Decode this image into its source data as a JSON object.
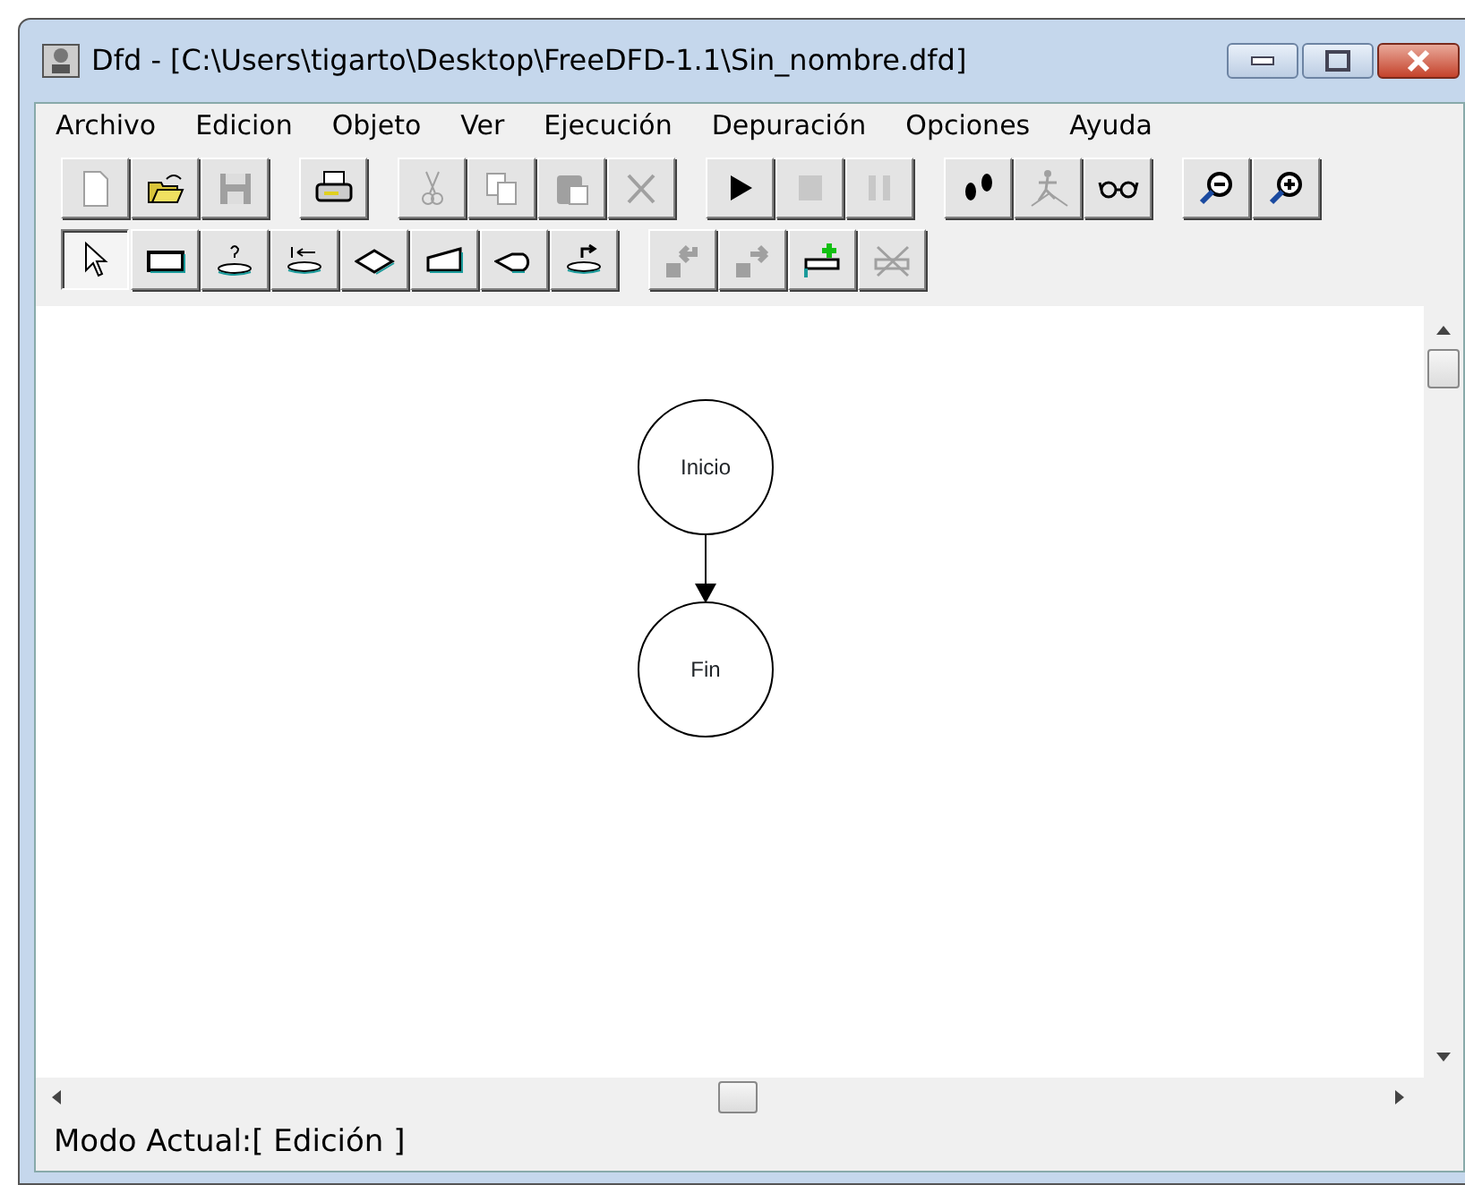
{
  "window": {
    "title": "Dfd - [C:\\Users\\tigarto\\Desktop\\FreeDFD-1.1\\Sin_nombre.dfd]"
  },
  "menu": [
    "Archivo",
    "Edicion",
    "Objeto",
    "Ver",
    "Ejecución",
    "Depuración",
    "Opciones",
    "Ayuda"
  ],
  "toolbars": [
    [
      [
        {
          "kind": "new",
          "disabled": true
        },
        {
          "kind": "open",
          "disabled": false
        },
        {
          "kind": "save",
          "disabled": true
        }
      ],
      [
        {
          "kind": "print",
          "disabled": false
        }
      ],
      [
        {
          "kind": "cut",
          "disabled": true
        },
        {
          "kind": "copy",
          "disabled": true
        },
        {
          "kind": "paste",
          "disabled": true
        },
        {
          "kind": "delete",
          "disabled": true
        }
      ],
      [
        {
          "kind": "run",
          "disabled": false
        },
        {
          "kind": "stop",
          "disabled": true
        },
        {
          "kind": "pause",
          "disabled": true
        }
      ],
      [
        {
          "kind": "step",
          "disabled": false
        },
        {
          "kind": "runner",
          "disabled": true
        },
        {
          "kind": "glasses",
          "disabled": false
        }
      ],
      [
        {
          "kind": "zoomout",
          "disabled": false
        },
        {
          "kind": "zoomin",
          "disabled": false
        }
      ]
    ],
    [
      [
        {
          "kind": "pointer",
          "disabled": false,
          "selected": true
        },
        {
          "kind": "process",
          "disabled": false,
          "selected": false
        },
        {
          "kind": "read",
          "disabled": false,
          "selected": false
        },
        {
          "kind": "assign",
          "disabled": false,
          "selected": false
        },
        {
          "kind": "decision",
          "disabled": false,
          "selected": false
        },
        {
          "kind": "output",
          "disabled": false,
          "selected": false
        },
        {
          "kind": "subprogram",
          "disabled": false,
          "selected": false
        },
        {
          "kind": "return",
          "disabled": false,
          "selected": false
        }
      ],
      [
        {
          "kind": "back",
          "disabled": true
        },
        {
          "kind": "forward",
          "disabled": true
        },
        {
          "kind": "addsub",
          "disabled": false
        },
        {
          "kind": "delsub",
          "disabled": true
        }
      ]
    ]
  ],
  "diagram": {
    "nodes": [
      {
        "label": "Inicio"
      },
      {
        "label": "Fin"
      }
    ]
  },
  "status_bar": "Modo Actual:[ Edición ]"
}
